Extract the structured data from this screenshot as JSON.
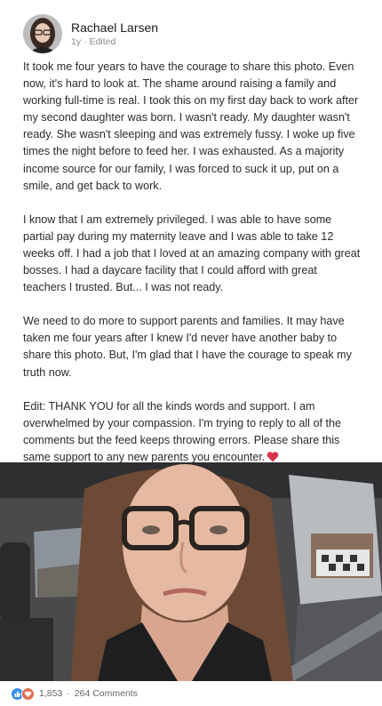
{
  "author": {
    "name": "Rachael Larsen",
    "time": "1y",
    "separator": "·",
    "edited": "Edited"
  },
  "post": {
    "paragraphs": [
      "It took me four years to have the courage to share this photo. Even now, it's hard to look at. The shame around raising a family and working full-time is real. I took this on my first day back to work after my second daughter was born. I wasn't ready. My daughter wasn't ready. She wasn't sleeping and was extremely fussy. I woke up five times the night before to feed her. I was exhausted. As a majority income source for our family, I was forced to suck it up, put on a smile, and get back to work.",
      "I know that I am extremely privileged. I was able to have some partial pay during my maternity leave and I was able to take 12 weeks off. I had a job that I loved at an amazing company with great bosses. I had a daycare facility that I could afford with great teachers I trusted. But... I was not ready.",
      "We need to do more to support parents and families. It may have taken me four years after I knew I'd never have another baby to share this photo. But, I'm glad that I have the courage to speak my truth now.",
      "Edit: THANK YOU for all the kinds words and support. I am overwhelmed by your compassion. I'm trying to reply to all of the comments but the feed keeps throwing errors. Please share this same support to any new parents you encounter."
    ],
    "emoji": "heart-icon"
  },
  "social": {
    "reaction_icons": [
      "like-icon",
      "heart-icon"
    ],
    "reaction_count": "1,853",
    "separator": "·",
    "comments": "264 Comments"
  },
  "colors": {
    "like_blue": "#378fe9",
    "love_red": "#df704d",
    "heart_red": "#d9344a"
  }
}
